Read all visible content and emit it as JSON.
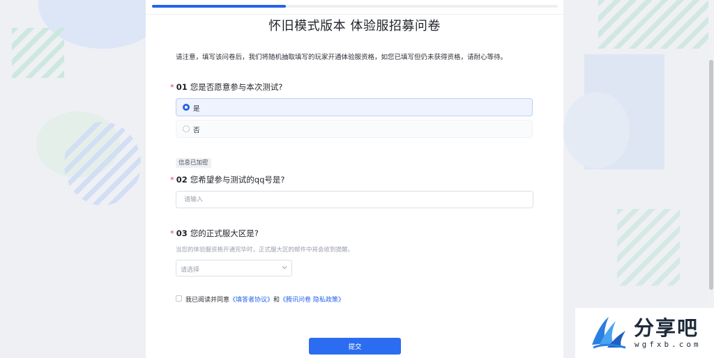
{
  "progress": {
    "value": 0.33
  },
  "survey": {
    "title": "怀旧模式版本 体验服招募问卷",
    "intro": "请注意，填写该问卷后，我们将随机抽取填写的玩家开通体验服资格，如您已填写但仍未获得资格，请耐心等待。"
  },
  "q1": {
    "required": "*",
    "number": "01",
    "text": "您是否愿意参与本次测试?",
    "options": [
      {
        "label": "是",
        "selected": true
      },
      {
        "label": "否",
        "selected": false
      }
    ]
  },
  "encrypted_badge": "信息已加密",
  "q2": {
    "required": "*",
    "number": "02",
    "text": "您希望参与测试的qq号是?",
    "placeholder": "请输入",
    "value": ""
  },
  "q3": {
    "required": "*",
    "number": "03",
    "text": "您的正式服大区是?",
    "hint": "当您的体验服资格开通完毕时，正式服大区的邮件中将会收到提醒。",
    "select_placeholder": "请选择"
  },
  "agreement": {
    "prefix": "我已阅读并同意",
    "link1": "《填答者协议》",
    "middle": "和",
    "link2": "《腾讯问卷 隐私政策》"
  },
  "submit_label": "提交",
  "watermark": {
    "text": "分享吧",
    "url": "wgfxb.com"
  },
  "colors": {
    "accent": "#2463eb",
    "required": "#e34d59",
    "page_bg": "#eef0f4"
  }
}
